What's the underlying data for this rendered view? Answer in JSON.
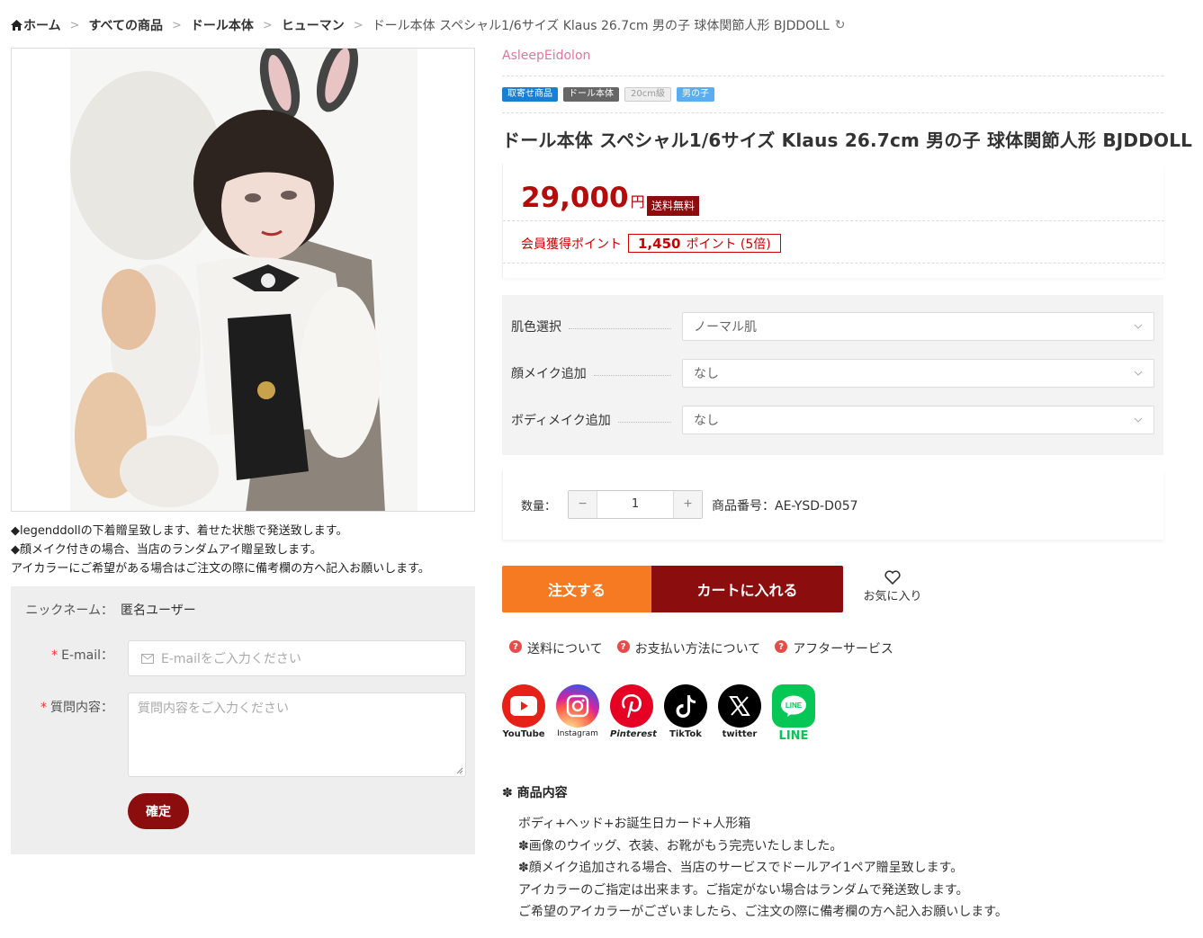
{
  "breadcrumb": {
    "home": "ホーム",
    "items": [
      "すべての商品",
      "ドール本体",
      "ヒューマン"
    ],
    "current": "ドール本体 スペシャル1/6サイズ Klaus 26.7cm 男の子 球体関節人形 BJDDOLL"
  },
  "product": {
    "brand": "AsleepEidolon",
    "tags": [
      "取寄せ商品",
      "ドール本体",
      "20cm級",
      "男の子"
    ],
    "title": "ドール本体 スペシャル1/6サイズ Klaus 26.7cm 男の子 球体関節人形 BJDDOLL",
    "price": "29,000",
    "currency": "円",
    "shipping_badge": "送料無料",
    "points_label": "会員獲得ポイント",
    "points_value": "1,450",
    "points_unit": "ポイント (5倍)"
  },
  "notes": [
    "◆legenddollの下着贈呈致します、着せた状態で発送致します。",
    "◆顔メイク付きの場合、当店のランダムアイ贈呈致します。",
    "アイカラーにご希望がある場合はご注文の際に備考欄の方へ記入お願いします。"
  ],
  "inquiry": {
    "nickname_label": "ニックネーム：",
    "nickname_value": "匿名ユーザー",
    "email_required": "*",
    "email_label": "E-mail：",
    "email_placeholder": "E-mailをご入力ください",
    "question_required": "*",
    "question_label": "質問内容：",
    "question_placeholder": "質問内容をご入力ください",
    "confirm_label": "確定"
  },
  "options": [
    {
      "label": "肌色選択",
      "value": "ノーマル肌"
    },
    {
      "label": "顔メイク追加",
      "value": "なし"
    },
    {
      "label": "ボディメイク追加",
      "value": "なし"
    }
  ],
  "quantity": {
    "label": "数量：",
    "value": "1",
    "minus": "−",
    "plus": "+",
    "sku": "商品番号：AE-YSD-D057"
  },
  "actions": {
    "order": "注文する",
    "cart": "カートに入れる",
    "favorite": "お気に入り"
  },
  "info_links": [
    "送料について",
    "お支払い方法について",
    "アフターサービス"
  ],
  "socials": [
    {
      "name": "YouTube",
      "caption": "YouTube",
      "color": "#e62117"
    },
    {
      "name": "Instagram",
      "caption": "Instagram",
      "color": "#d6249f"
    },
    {
      "name": "Pinterest",
      "caption": "Pinterest",
      "color": "#e60023"
    },
    {
      "name": "TikTok",
      "caption": "TikTok",
      "color": "#000000"
    },
    {
      "name": "twitter",
      "caption": "twitter",
      "color": "#000000"
    },
    {
      "name": "LINE",
      "caption": "LINE",
      "color": "#06c755"
    }
  ],
  "contents": {
    "heading": "✽ 商品内容",
    "lines": [
      "ボディ+ヘッド+お誕生日カード+人形箱",
      "✽画像のウイッグ、衣装、お靴がもう完売いたしました。",
      "✽顔メイク追加される場合、当店のサービスでドールアイ1ペア贈呈致します。",
      "アイカラーのご指定は出来ます。ご指定がない場合はランダムで発送致します。",
      "ご希望のアイカラーがございましたら、ご注文の際に備考欄の方へ記入お願いします。"
    ]
  },
  "colors": {
    "accent_dark_red": "#8b0d0d",
    "price_red": "#b40b0b",
    "order_orange": "#f57a21",
    "brand_pink": "#e0779b"
  }
}
